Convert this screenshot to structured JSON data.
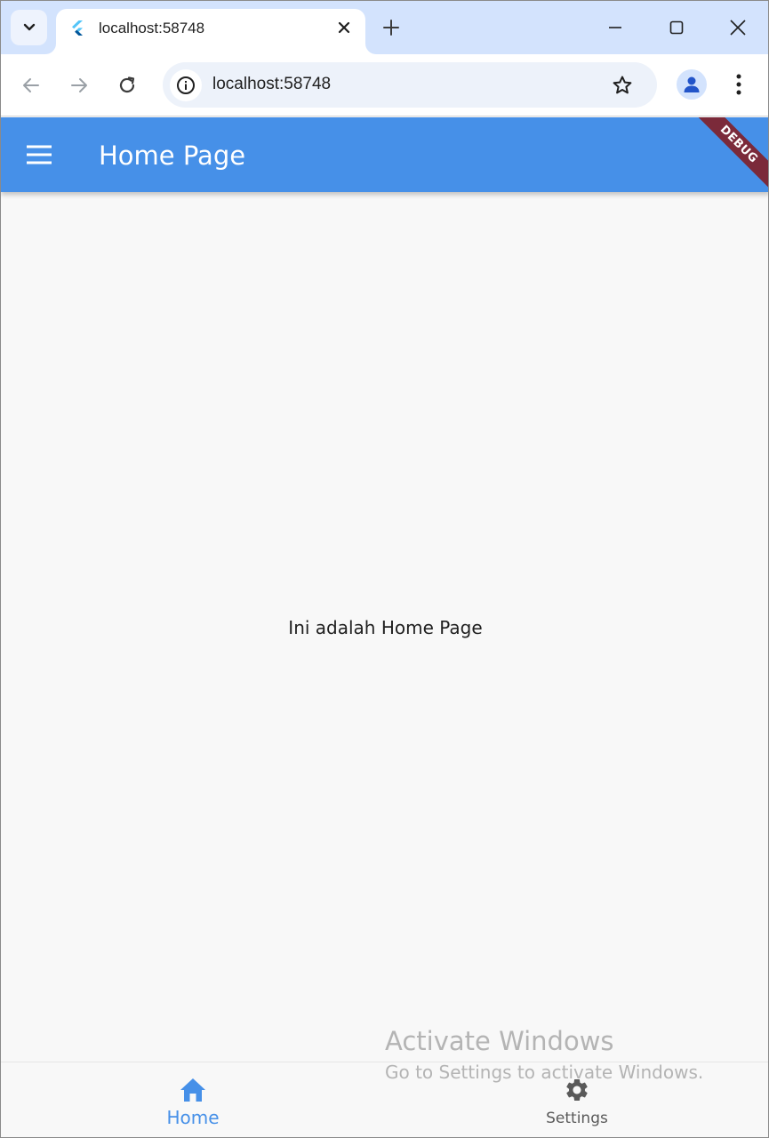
{
  "browser": {
    "tab_title": "localhost:58748",
    "url": "localhost:58748",
    "accent": "#d3e3fd"
  },
  "app": {
    "appbar_title": "Home Page",
    "debug_banner": "DEBUG",
    "body_text": "Ini adalah Home Page",
    "primary_color": "#4690e8"
  },
  "bottom_nav": {
    "items": [
      {
        "label": "Home",
        "icon": "home-icon",
        "active": true
      },
      {
        "label": "Settings",
        "icon": "gear-icon",
        "active": false
      }
    ]
  },
  "watermark": {
    "title": "Activate Windows",
    "subtitle": "Go to Settings to activate Windows."
  }
}
